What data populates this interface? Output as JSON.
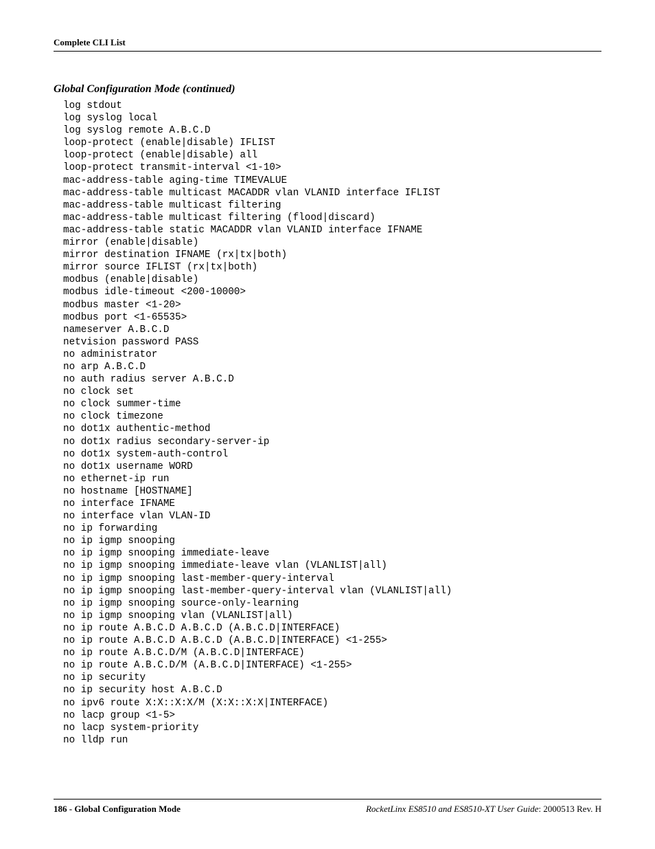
{
  "header": {
    "title": "Complete CLI List"
  },
  "section": {
    "title": "Global Configuration Mode (continued)"
  },
  "cli_lines": [
    "log stdout",
    "log syslog local",
    "log syslog remote A.B.C.D",
    "loop-protect (enable|disable) IFLIST",
    "loop-protect (enable|disable) all",
    "loop-protect transmit-interval <1-10>",
    "mac-address-table aging-time TIMEVALUE",
    "mac-address-table multicast MACADDR vlan VLANID interface IFLIST",
    "mac-address-table multicast filtering",
    "mac-address-table multicast filtering (flood|discard)",
    "mac-address-table static MACADDR vlan VLANID interface IFNAME",
    "mirror (enable|disable)",
    "mirror destination IFNAME (rx|tx|both)",
    "mirror source IFLIST (rx|tx|both)",
    "modbus (enable|disable)",
    "modbus idle-timeout <200-10000>",
    "modbus master <1-20>",
    "modbus port <1-65535>",
    "nameserver A.B.C.D",
    "netvision password PASS",
    "no administrator",
    "no arp A.B.C.D",
    "no auth radius server A.B.C.D",
    "no clock set",
    "no clock summer-time",
    "no clock timezone",
    "no dot1x authentic-method",
    "no dot1x radius secondary-server-ip",
    "no dot1x system-auth-control",
    "no dot1x username WORD",
    "no ethernet-ip run",
    "no hostname [HOSTNAME]",
    "no interface IFNAME",
    "no interface vlan VLAN-ID",
    "no ip forwarding",
    "no ip igmp snooping",
    "no ip igmp snooping immediate-leave",
    "no ip igmp snooping immediate-leave vlan (VLANLIST|all)",
    "no ip igmp snooping last-member-query-interval",
    "no ip igmp snooping last-member-query-interval vlan (VLANLIST|all)",
    "no ip igmp snooping source-only-learning",
    "no ip igmp snooping vlan (VLANLIST|all)",
    "no ip route A.B.C.D A.B.C.D (A.B.C.D|INTERFACE)",
    "no ip route A.B.C.D A.B.C.D (A.B.C.D|INTERFACE) <1-255>",
    "no ip route A.B.C.D/M (A.B.C.D|INTERFACE)",
    "no ip route A.B.C.D/M (A.B.C.D|INTERFACE) <1-255>",
    "no ip security",
    "no ip security host A.B.C.D",
    "no ipv6 route X:X::X:X/M (X:X::X:X|INTERFACE)",
    "no lacp group <1-5>",
    "no lacp system-priority",
    "no lldp run"
  ],
  "footer": {
    "left": "186 - Global Configuration Mode",
    "right_italic": "RocketLinx ES8510  and ES8510-XT User Guide",
    "right_plain": ": 2000513 Rev. H"
  }
}
